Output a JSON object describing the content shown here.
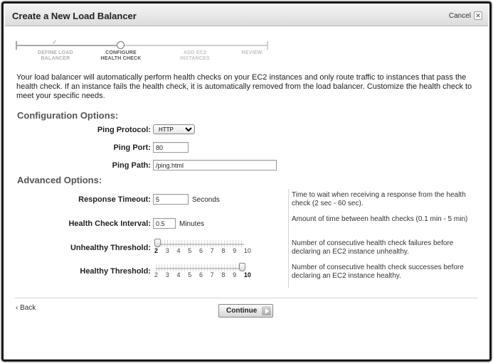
{
  "dialog": {
    "title": "Create a New Load Balancer",
    "cancel_label": "Cancel",
    "cancel_icon": "close-icon"
  },
  "wizard": {
    "steps": [
      {
        "label_line1": "DEFINE LOAD",
        "label_line2": "BALANCER",
        "state": "done"
      },
      {
        "label_line1": "CONFIGURE",
        "label_line2": "HEALTH CHECK",
        "state": "current"
      },
      {
        "label_line1": "ADD EC2",
        "label_line2": "INSTANCES",
        "state": "upcoming"
      },
      {
        "label_line1": "REVIEW",
        "label_line2": "",
        "state": "upcoming"
      }
    ],
    "done_icon": "check-icon"
  },
  "intro": "Your load balancer will automatically perform health checks on your EC2 instances and only route traffic to instances that pass the health check. If an instance fails the health check, it is automatically removed from the load balancer. Customize the health check to meet your specific needs.",
  "config": {
    "heading": "Configuration Options:",
    "ping_protocol_label": "Ping Protocol:",
    "ping_protocol_value": "HTTP",
    "ping_port_label": "Ping Port:",
    "ping_port_value": "80",
    "ping_path_label": "Ping Path:",
    "ping_path_value": "/ping.html"
  },
  "advanced": {
    "heading": "Advanced Options:",
    "response_timeout_label": "Response Timeout:",
    "response_timeout_value": "5",
    "response_timeout_unit": "Seconds",
    "response_timeout_help": "Time to wait when receiving a response from the health check (2 sec - 60 sec).",
    "interval_label": "Health Check Interval:",
    "interval_value": "0.5",
    "interval_unit": "Minutes",
    "interval_help": "Amount of time between health checks (0.1 min - 5 min)",
    "unhealthy_label": "Unhealthy Threshold:",
    "unhealthy_value": 2,
    "unhealthy_help": "Number of consecutive health check failures before declaring an EC2 instance unhealthy.",
    "healthy_label": "Healthy Threshold:",
    "healthy_value": 10,
    "healthy_help": "Number of consecutive health check successes before declaring an EC2 instance healthy.",
    "scale": [
      "2",
      "3",
      "4",
      "5",
      "6",
      "7",
      "8",
      "9",
      "10"
    ]
  },
  "footer": {
    "back_label": "‹ Back",
    "continue_label": "Continue",
    "continue_icon": "arrow-right-icon"
  }
}
